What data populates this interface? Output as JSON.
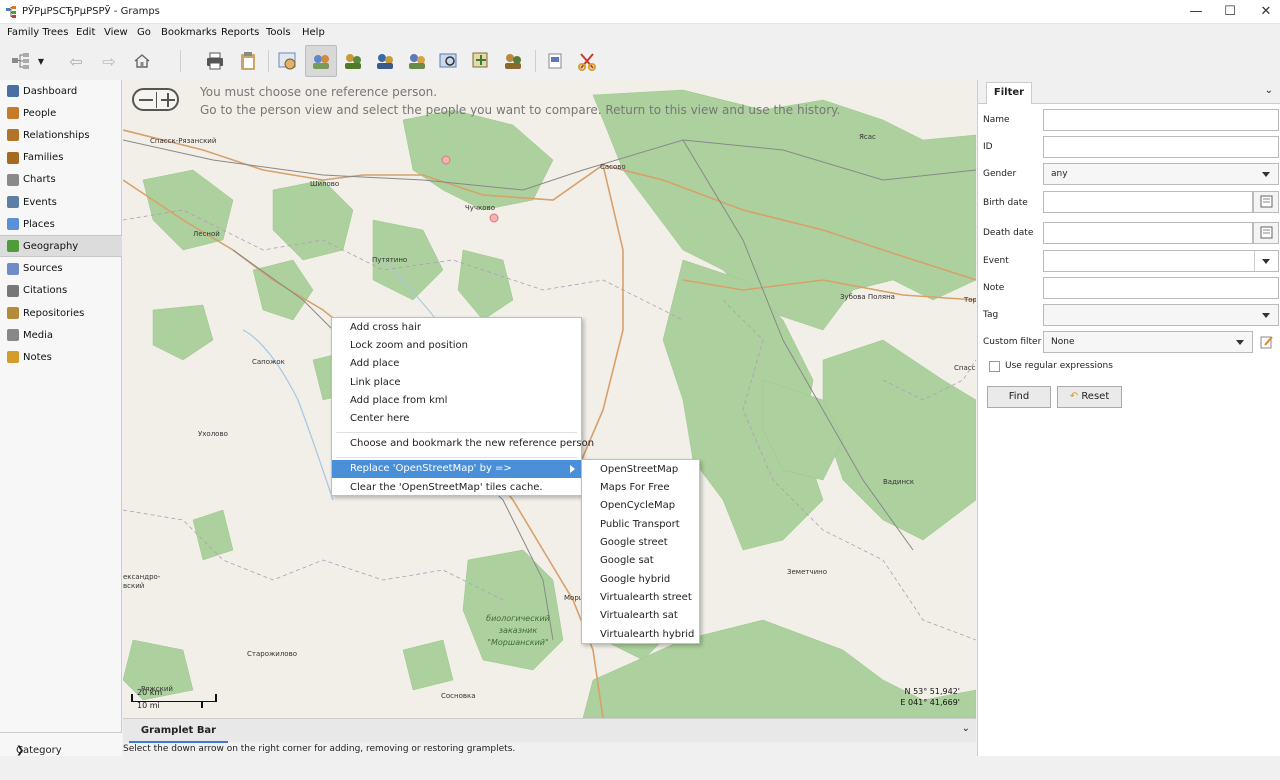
{
  "window": {
    "title": "РЎРµРЅСЂРµРЅРЎ - Gramps",
    "controls": [
      "—",
      "☐",
      "✕"
    ]
  },
  "menubar": [
    "Family Trees",
    "Edit",
    "View",
    "Go",
    "Bookmarks",
    "Reports",
    "Tools",
    "Help"
  ],
  "sidebar": {
    "items": [
      {
        "label": "Dashboard",
        "icon": "dashboard-icon",
        "color": "#4a6fa5"
      },
      {
        "label": "People",
        "icon": "people-icon",
        "color": "#c77b2a"
      },
      {
        "label": "Relationships",
        "icon": "relationships-icon",
        "color": "#b3742a"
      },
      {
        "label": "Families",
        "icon": "families-icon",
        "color": "#a56a20"
      },
      {
        "label": "Charts",
        "icon": "charts-icon",
        "color": "#8a8a8a"
      },
      {
        "label": "Events",
        "icon": "events-icon",
        "color": "#5d7fa6"
      },
      {
        "label": "Places",
        "icon": "places-icon",
        "color": "#5c8fd6"
      },
      {
        "label": "Geography",
        "icon": "geography-icon",
        "color": "#4f9c3a"
      },
      {
        "label": "Sources",
        "icon": "sources-icon",
        "color": "#6e8cc7"
      },
      {
        "label": "Citations",
        "icon": "citations-icon",
        "color": "#777"
      },
      {
        "label": "Repositories",
        "icon": "repositories-icon",
        "color": "#b58a3a"
      },
      {
        "label": "Media",
        "icon": "media-icon",
        "color": "#888"
      },
      {
        "label": "Notes",
        "icon": "notes-icon",
        "color": "#d59c2a"
      }
    ],
    "selected": "Geography",
    "category_label": "Category"
  },
  "map": {
    "message_line1": "You must choose one reference person.",
    "message_line2": "Go to the person view and select the people you want to compare. Return to this view and use the history.",
    "towns": [
      "Спасск-Рязанский",
      "Шилово",
      "Чучково",
      "Сасово",
      "Ясас",
      "Лесной",
      "Путятино",
      "Зубова Поляна",
      "Сапожок",
      "Ухолово",
      "Вадинск",
      "Земетчино",
      "ександро-\nвский",
      "Старожилово",
      "Морш",
      "Спасс",
      "Тор",
      "Сосновка",
      "Ряжский"
    ],
    "reserve_label_lines": [
      "биологический",
      "заказник",
      "\"Моршанский\""
    ],
    "scale_km": "20 km",
    "scale_mi": "10 mi",
    "coord_n": "N 53° 51,942'",
    "coord_e": "E 041° 41,669'"
  },
  "context_menu": {
    "items": [
      "Add cross hair",
      "Lock zoom and position",
      "Add place",
      "Link place",
      "Add place from kml",
      "Center here",
      "Choose and bookmark the new reference person",
      "Replace 'OpenStreetMap' by =>",
      "Clear the 'OpenStreetMap' tiles cache."
    ],
    "highlighted_index": 7
  },
  "submenu": {
    "items": [
      "OpenStreetMap",
      "Maps For Free",
      "OpenCycleMap",
      "Public Transport",
      "Google street",
      "Google sat",
      "Google hybrid",
      "Virtualearth street",
      "Virtualearth sat",
      "Virtualearth hybrid"
    ]
  },
  "gramplet": {
    "tab_label": "Gramplet Bar",
    "status_text": "Select the down arrow on the right corner for adding, removing or restoring gramplets."
  },
  "filter": {
    "tab_label": "Filter",
    "fields": {
      "name_label": "Name",
      "id_label": "ID",
      "gender_label": "Gender",
      "gender_value": "any",
      "birth_label": "Birth date",
      "death_label": "Death date",
      "event_label": "Event",
      "note_label": "Note",
      "tag_label": "Tag",
      "custom_label": "Custom filter",
      "custom_value": "None",
      "regex_label": "Use regular expressions"
    },
    "find_label": "Find",
    "reset_label": "Reset"
  },
  "colors": {
    "accent": "#4a90d9",
    "map_bg": "#f2efe9",
    "forest": "#add19e",
    "road": "#d8a06a"
  }
}
